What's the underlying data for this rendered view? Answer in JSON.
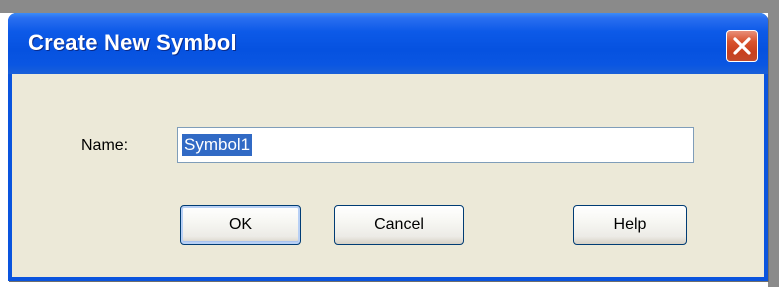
{
  "window": {
    "title": "Create New Symbol"
  },
  "form": {
    "name_label": "Name:",
    "name_value": "Symbol1"
  },
  "buttons": {
    "ok": "OK",
    "cancel": "Cancel",
    "help": "Help"
  },
  "icons": {
    "close": "close-icon"
  },
  "colors": {
    "titlebar": "#0652e0",
    "close_button": "#d9542e",
    "dialog_body": "#ece9d8",
    "selection": "#316ac5"
  }
}
